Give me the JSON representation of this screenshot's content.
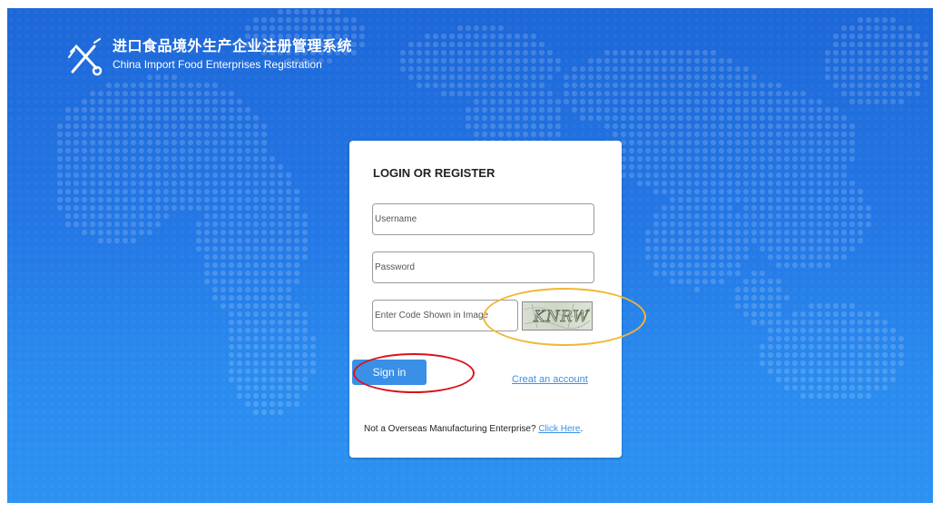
{
  "header": {
    "title_cn": "进口食品境外生产企业注册管理系统",
    "title_en": "China Import Food Enterprises Registration",
    "logo_icon": "tools-cross-icon"
  },
  "login": {
    "title": "LOGIN OR REGISTER",
    "username_placeholder": "Username",
    "password_placeholder": "Password",
    "captcha_placeholder": "Enter Code Shown in Image",
    "captcha_text": "KNRW",
    "signin_label": "Sign in",
    "create_account_label": "Creat an account",
    "footer_text": "Not a Overseas Manufacturing Enterprise?",
    "footer_link": "Click Here",
    "footer_end": "."
  },
  "colors": {
    "background_top": "#1d67d8",
    "background_bottom": "#2c92f2",
    "accent": "#3a8fe6",
    "highlight_red": "#d8141a",
    "highlight_orange": "#f2b632"
  }
}
